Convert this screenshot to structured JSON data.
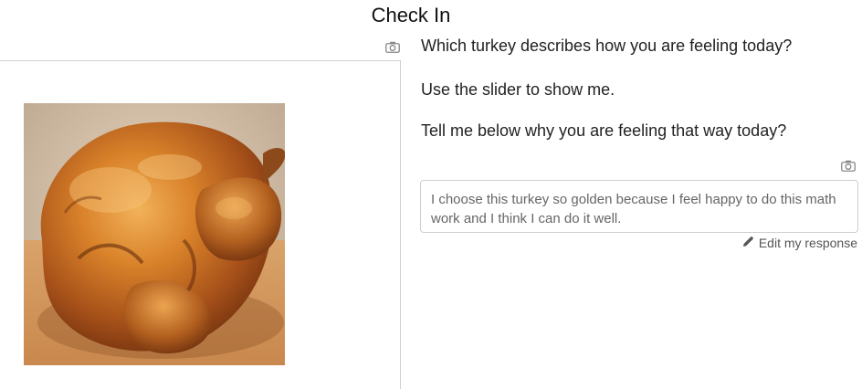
{
  "header": {
    "title": "Check In"
  },
  "image": {
    "alt": "turkey",
    "camera_icon": "camera-icon"
  },
  "questions": {
    "q1": "Which turkey describes how you are feeling today?",
    "q2": "Use the slider to show me.",
    "q3": "Tell me below why you are feeling that way today?"
  },
  "response": {
    "text": "I choose this turkey so golden because I feel happy to do this math work and I think I can do it well.",
    "camera_icon": "camera-icon",
    "edit_label": "Edit my response",
    "edit_icon": "pencil-icon"
  }
}
